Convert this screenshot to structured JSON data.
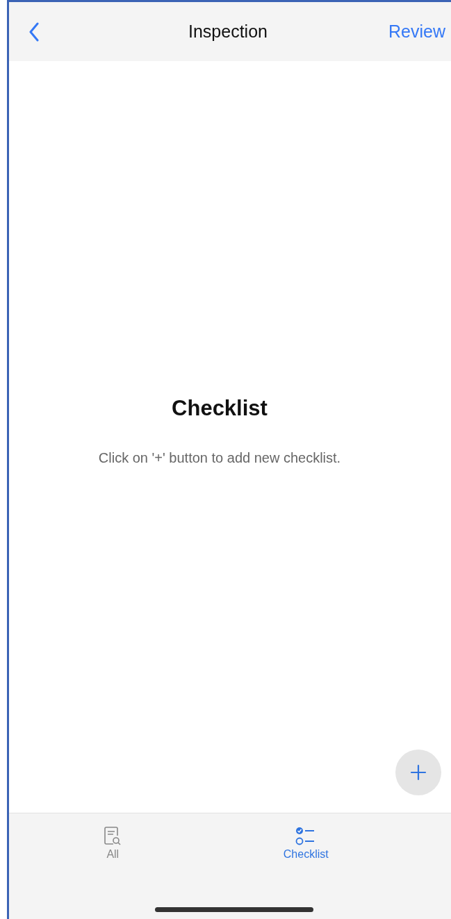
{
  "nav": {
    "title": "Inspection",
    "action": "Review"
  },
  "empty_state": {
    "title": "Checklist",
    "message": "Click on '+' button to add new checklist."
  },
  "tabs": [
    {
      "label": "All",
      "kind": "all",
      "selected": false
    },
    {
      "label": "Checklist",
      "kind": "checklist",
      "selected": true
    }
  ]
}
